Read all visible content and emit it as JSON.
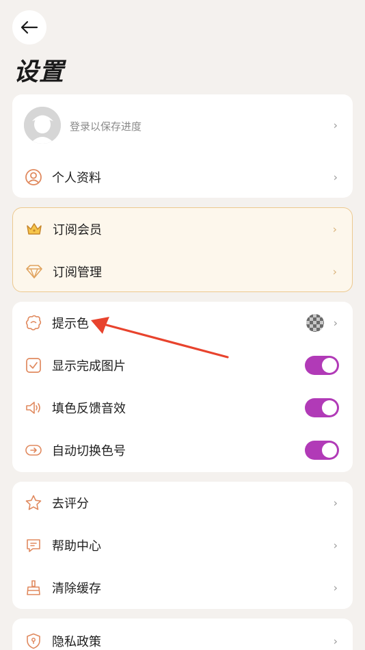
{
  "header": {
    "back_icon": "arrow-left-icon",
    "title": "设置"
  },
  "account": {
    "login_prompt": "登录以保存进度",
    "profile_label": "个人资料"
  },
  "membership": {
    "subscribe_label": "订阅会员",
    "manage_label": "订阅管理"
  },
  "preferences": {
    "hint_color_label": "提示色",
    "show_completed_label": "显示完成图片",
    "show_completed_on": true,
    "fill_sound_label": "填色反馈音效",
    "fill_sound_on": true,
    "auto_switch_label": "自动切换色号",
    "auto_switch_on": true
  },
  "support": {
    "rate_label": "去评分",
    "help_label": "帮助中心",
    "clear_cache_label": "清除缓存"
  },
  "legal": {
    "privacy_label": "隐私政策"
  },
  "colors": {
    "accent_toggle": "#b13ab7",
    "icon_orange": "#e0895e",
    "gold_border": "#ecc88e",
    "annotation_arrow": "#e8432d"
  }
}
